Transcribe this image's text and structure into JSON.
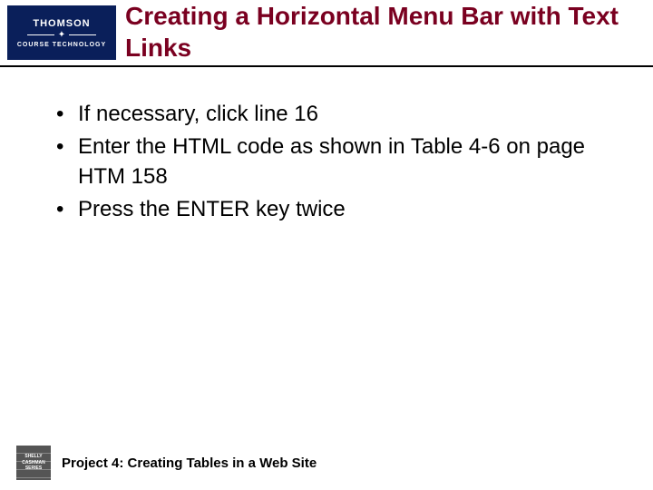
{
  "header": {
    "logo_top": "THOMSON",
    "logo_bottom": "COURSE TECHNOLOGY",
    "title": "Creating a Horizontal Menu Bar with Text Links"
  },
  "bullets": [
    "If necessary, click line 16",
    "Enter the HTML code as shown in Table 4-6 on page HTM 158",
    "Press the ENTER key twice"
  ],
  "footer": {
    "logo_line1": "SHELLY",
    "logo_line2": "CASHMAN",
    "logo_line3": "SERIES",
    "text": "Project 4: Creating Tables in a Web Site"
  }
}
